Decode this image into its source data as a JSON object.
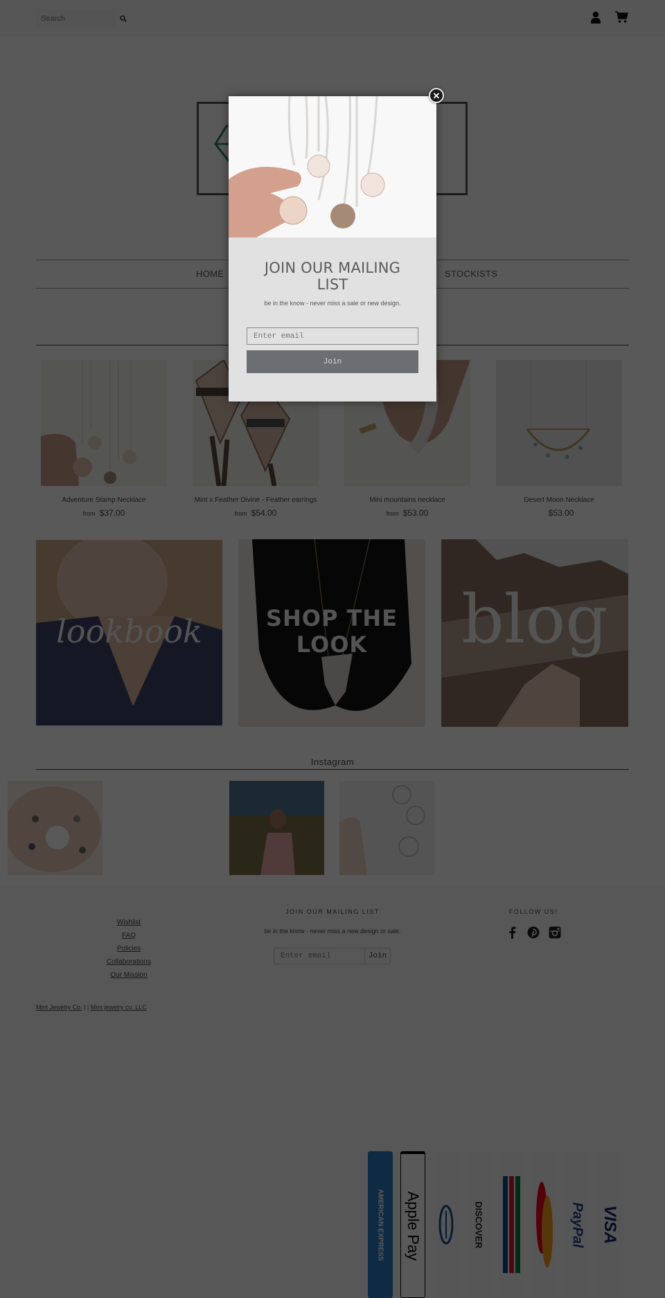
{
  "header": {
    "search_placeholder": "Search",
    "icons": {
      "search": "search-icon",
      "account": "user-icon",
      "cart": "cart-icon"
    }
  },
  "logo": {
    "icon": "diamond-icon"
  },
  "nav": {
    "items": [
      {
        "label": "HOME"
      },
      {
        "label": "STOCKISTS"
      }
    ]
  },
  "products": [
    {
      "name": "Adventure Stamp Necklace",
      "from_label": "from",
      "price": "$37.00"
    },
    {
      "name": "Mint x Feather Divine - Feather earrings",
      "from_label": "from",
      "price": "$54.00"
    },
    {
      "name": "Mini mountains necklace",
      "from_label": "from",
      "price": "$53.00"
    },
    {
      "name": "Desert Moon Necklace",
      "from_label": "",
      "price": "$53.00"
    }
  ],
  "features": [
    {
      "label": "lookbook"
    },
    {
      "label": "SHOP THE LOOK"
    },
    {
      "label": "blog"
    }
  ],
  "instagram": {
    "title": "Instagram",
    "photo_count": 3
  },
  "footer": {
    "links": [
      "Wishlist",
      "FAQ",
      "Policies",
      "Collaborations",
      "Our Mission"
    ],
    "mailing": {
      "title": "JOIN OUR MAILING LIST",
      "subtitle": "be in the know - never miss a new design or sale.",
      "placeholder": "Enter email",
      "button": "Join"
    },
    "follow": {
      "title": "FOLLOW US!",
      "networks": [
        "facebook",
        "pinterest",
        "instagram"
      ]
    },
    "legal": {
      "left": "Mint Jewelry Co.",
      "separator": "| |",
      "right": "Mint jewelry co. LLC"
    },
    "payments": [
      "AMERICAN EXPRESS",
      "Apple Pay",
      "Diners Club",
      "DISCOVER",
      "JCB",
      "MasterCard",
      "PayPal",
      "VISA"
    ]
  },
  "modal": {
    "title": "JOIN OUR MAILING LIST",
    "subtitle": "be in the know - never miss a sale or new design.",
    "email_placeholder": "Enter email",
    "join_label": "Join",
    "close_symbol": "✕"
  }
}
